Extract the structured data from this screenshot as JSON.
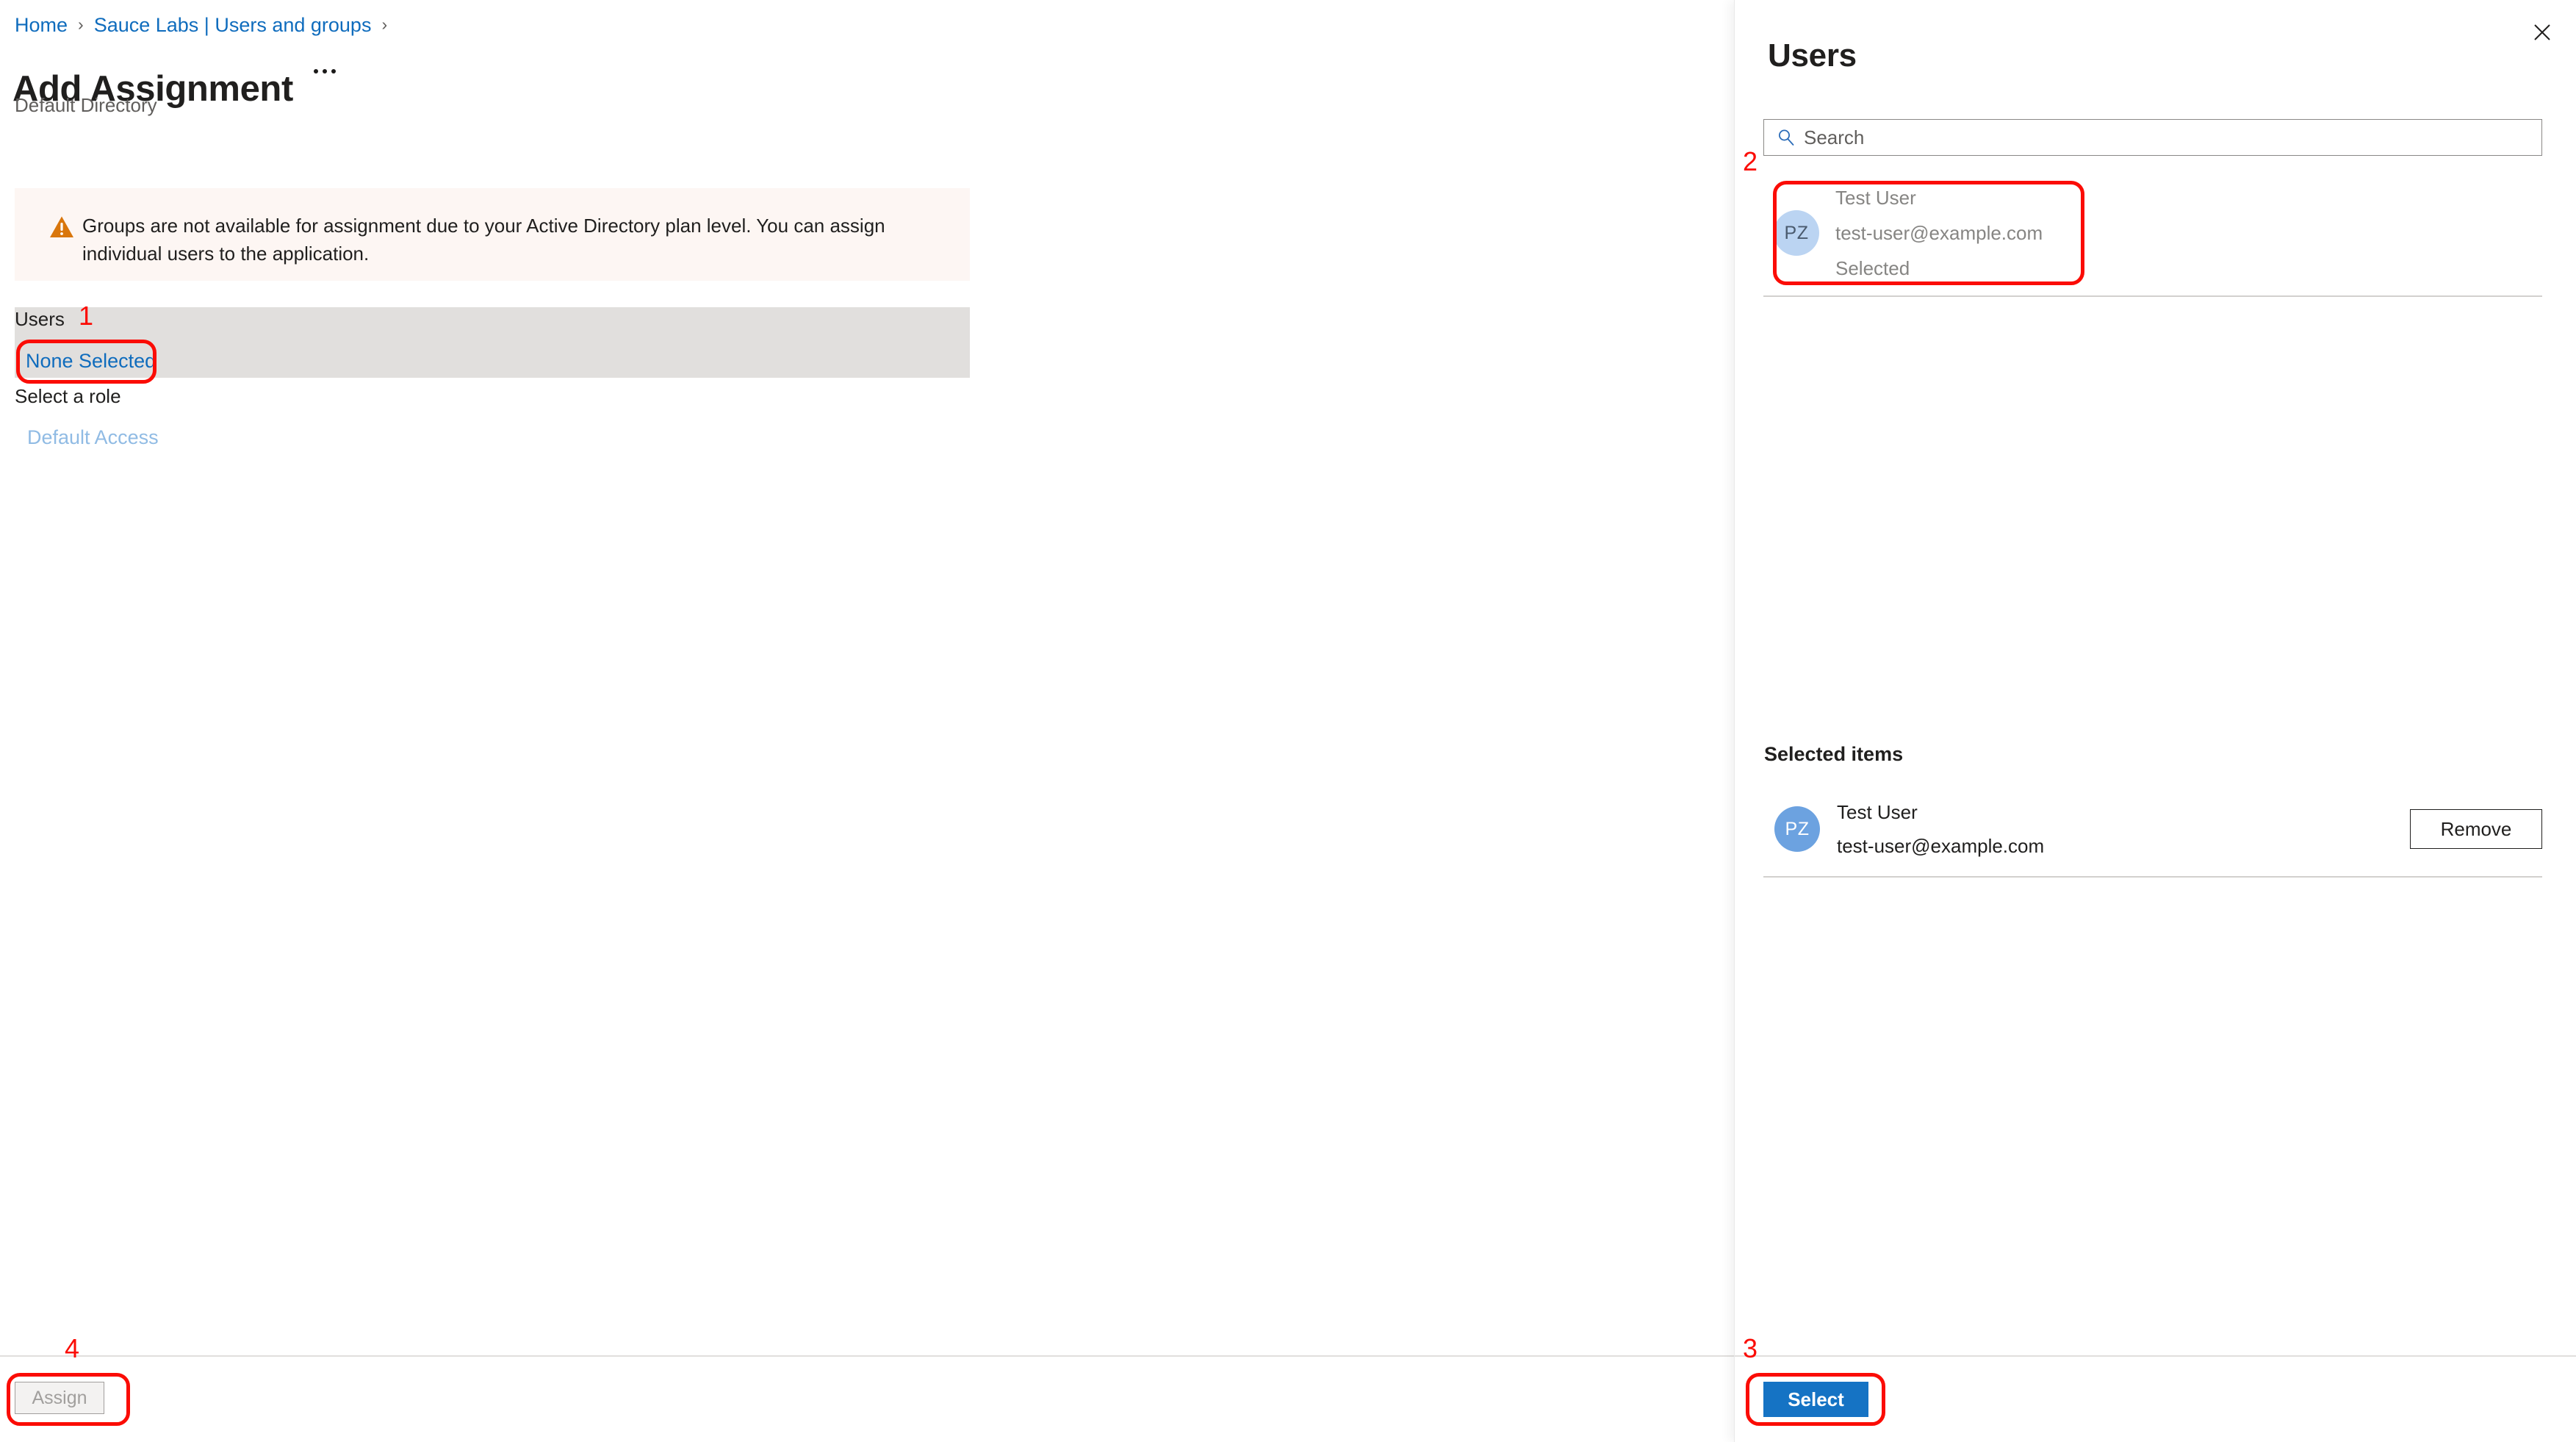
{
  "breadcrumb": {
    "items": [
      {
        "label": "Home"
      },
      {
        "label": "Sauce Labs | Users and groups"
      }
    ],
    "separator": "›"
  },
  "header": {
    "title": "Add Assignment",
    "subtitle": "Default Directory",
    "ellipsis_icon": "ellipsis-icon"
  },
  "warning": {
    "icon": "warning-triangle-icon",
    "text": "Groups are not available for assignment due to your Active Directory plan level. You can assign individual users to the application."
  },
  "form": {
    "users_label": "Users",
    "users_value": "None Selected",
    "role_label": "Select a role",
    "role_value": "Default Access"
  },
  "footer": {
    "assign_label": "Assign",
    "assign_disabled": true
  },
  "panel": {
    "title": "Users",
    "close_icon": "close-icon",
    "search": {
      "icon": "search-icon",
      "placeholder": "Search",
      "value": ""
    },
    "results": [
      {
        "initials": "PZ",
        "name": "Test User",
        "email": "test-user@example.com",
        "status": "Selected"
      }
    ],
    "selected_items_heading": "Selected items",
    "selected_items": [
      {
        "initials": "PZ",
        "name": "Test User",
        "email": "test-user@example.com",
        "remove_label": "Remove"
      }
    ],
    "select_label": "Select"
  },
  "annotations": [
    {
      "number": "1"
    },
    {
      "number": "2"
    },
    {
      "number": "3"
    },
    {
      "number": "4"
    }
  ],
  "colors": {
    "link": "#0f6cbd",
    "primary_button": "#1573c4",
    "warning_bg": "#fdf6f3",
    "warning_icon": "#d83b01",
    "field_bg": "#e1dfdd",
    "annotation": "#fb0c05"
  }
}
